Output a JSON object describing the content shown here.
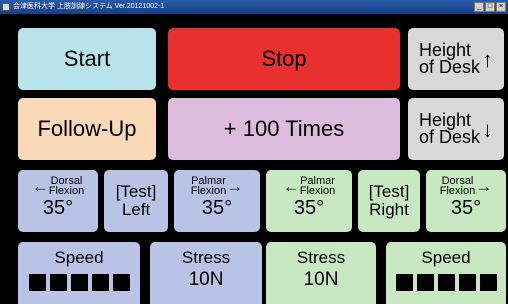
{
  "window": {
    "title": "会津医科大学 上肢訓練システム Ver.20121002-1",
    "buttons": [
      "_",
      "□",
      "×"
    ]
  },
  "row1": {
    "start": "Start",
    "stop": "Stop",
    "height_up": {
      "line1": "Height",
      "line2": "of Desk",
      "arrow": "↑"
    }
  },
  "row2": {
    "follow_up": "Follow-Up",
    "plus_times": "+ 100 Times",
    "height_down": {
      "line1": "Height",
      "line2": "of Desk",
      "arrow": "↓"
    }
  },
  "row3": {
    "left_dorsal": {
      "line1": "Dorsal",
      "line2": "Flexion",
      "arrow": "←",
      "degree": "35°"
    },
    "test_left": {
      "line1": "[Test]",
      "line2": "Left"
    },
    "left_palmar": {
      "line1": "Palmar",
      "line2": "Flexion",
      "arrow": "→",
      "degree": "35°"
    },
    "right_palmar": {
      "line1": "Palmar",
      "line2": "Flexion",
      "arrow": "←",
      "degree": "35°"
    },
    "test_right": {
      "line1": "[Test]",
      "line2": "Right"
    },
    "right_dorsal": {
      "line1": "Dorsal",
      "line2": "Flexion",
      "arrow": "→",
      "degree": "35°"
    }
  },
  "row4": {
    "left_speed": {
      "label": "Speed",
      "level": 5
    },
    "left_stress": {
      "label": "Stress",
      "value": "10N"
    },
    "right_stress": {
      "label": "Stress",
      "value": "10N"
    },
    "right_speed": {
      "label": "Speed",
      "level": 5
    }
  },
  "colors": {
    "left_panel": "#b9c3e6",
    "right_panel": "#c8e8c2",
    "start": "#b7e3ea",
    "stop": "#e8302f",
    "follow_up": "#f9d9b8",
    "plus_times": "#ddbbdc",
    "desk": "#d8d8d8"
  }
}
